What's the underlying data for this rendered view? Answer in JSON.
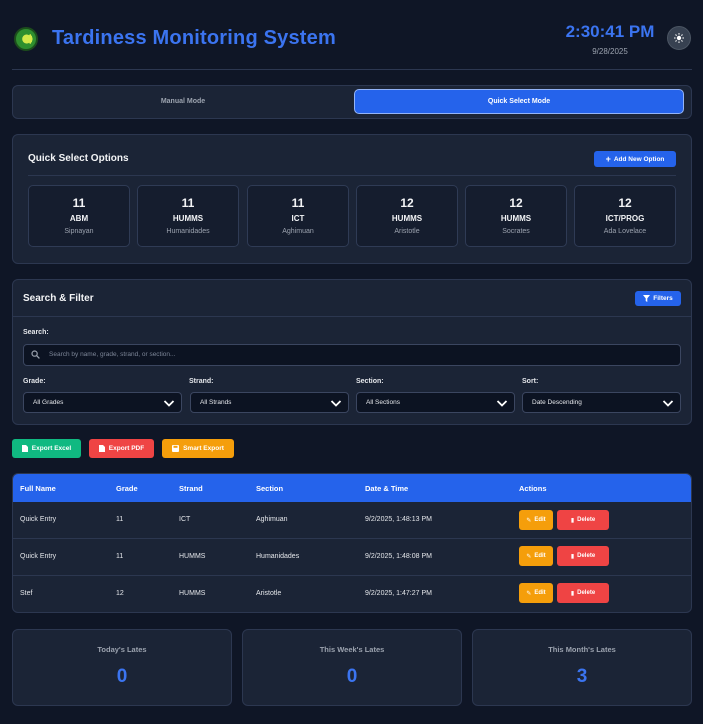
{
  "header": {
    "title": "Tardiness Monitoring System",
    "time": "2:30:41 PM",
    "date": "9/28/2025"
  },
  "modes": {
    "manual": "Manual Mode",
    "quick": "Quick Select Mode",
    "active": "quick"
  },
  "quick_select": {
    "title": "Quick Select Options",
    "add_label": "Add New Option",
    "options": [
      {
        "grade": "11",
        "strand": "ABM",
        "section": "Sipnayan"
      },
      {
        "grade": "11",
        "strand": "HUMMS",
        "section": "Humanidades"
      },
      {
        "grade": "11",
        "strand": "ICT",
        "section": "Aghimuan"
      },
      {
        "grade": "12",
        "strand": "HUMMS",
        "section": "Aristotle"
      },
      {
        "grade": "12",
        "strand": "HUMMS",
        "section": "Socrates"
      },
      {
        "grade": "12",
        "strand": "ICT/PROG",
        "section": "Ada Lovelace"
      }
    ]
  },
  "search_filter": {
    "title": "Search & Filter",
    "filters_label": "Filters",
    "search_label": "Search:",
    "search_placeholder": "Search by name, grade, strand, or section...",
    "grade_label": "Grade:",
    "grade_value": "All Grades",
    "strand_label": "Strand:",
    "strand_value": "All Strands",
    "section_label": "Section:",
    "section_value": "All Sections",
    "sort_label": "Sort:",
    "sort_value": "Date Descending"
  },
  "exports": {
    "excel": "Export Excel",
    "pdf": "Export PDF",
    "smart": "Smart Export"
  },
  "table": {
    "headers": [
      "Full Name",
      "Grade",
      "Strand",
      "Section",
      "Date & Time",
      "Actions"
    ],
    "rows": [
      {
        "name": "Quick Entry",
        "grade": "11",
        "strand": "ICT",
        "section": "Aghimuan",
        "datetime": "9/2/2025, 1:48:13 PM"
      },
      {
        "name": "Quick Entry",
        "grade": "11",
        "strand": "HUMMS",
        "section": "Humanidades",
        "datetime": "9/2/2025, 1:48:08 PM"
      },
      {
        "name": "Stef",
        "grade": "12",
        "strand": "HUMMS",
        "section": "Aristotle",
        "datetime": "9/2/2025, 1:47:27 PM"
      }
    ],
    "edit_label": "Edit",
    "delete_label": "Delete"
  },
  "stats": {
    "today_label": "Today's Lates",
    "today_value": "0",
    "week_label": "This Week's Lates",
    "week_value": "0",
    "month_label": "This Month's Lates",
    "month_value": "3"
  },
  "colors": {
    "background": "#0f1626",
    "panel": "#1b2436",
    "accent": "#2563eb",
    "excel": "#10b981",
    "pdf": "#ef4444",
    "smart": "#f59e0b"
  }
}
